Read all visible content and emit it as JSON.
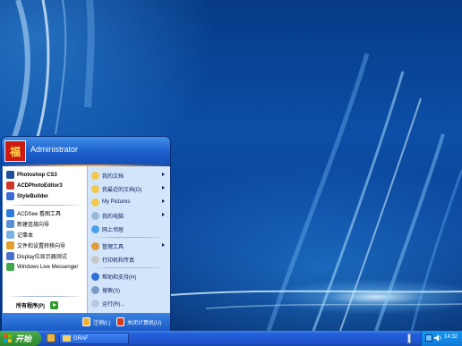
{
  "start_menu": {
    "username": "Administrator",
    "avatar_glyph": "福",
    "pinned": [
      {
        "label": "Photoshop CS3",
        "icon": "photoshop-icon",
        "color": "#1f4f9a"
      },
      {
        "label": "ACDPhotoEditor3",
        "icon": "acd-photo-editor-icon",
        "color": "#d0352a"
      },
      {
        "label": "StyleBuilder",
        "icon": "stylebuilder-icon",
        "color": "#3a6bd6"
      }
    ],
    "recent": [
      {
        "label": "ACDSee 看图工具",
        "icon": "acdsee-icon",
        "color": "#2f7bd8"
      },
      {
        "label": "新建连接向导",
        "icon": "network-wizard-icon",
        "color": "#5a8fd8"
      },
      {
        "label": "记事本",
        "icon": "notepad-icon",
        "color": "#7ab0e6"
      },
      {
        "label": "文件和设置转移向导",
        "icon": "transfer-wizard-icon",
        "color": "#e0a030"
      },
      {
        "label": "Display位显示器测试",
        "icon": "display-test-icon",
        "color": "#4a70c8"
      },
      {
        "label": "Windows Live Messenger",
        "icon": "messenger-icon",
        "color": "#3fa84a"
      }
    ],
    "all_programs_label": "所有程序(P)",
    "places": [
      {
        "label": "我的文档",
        "icon": "my-documents-icon",
        "color": "#f2c94c",
        "arrow": true,
        "bold": true
      },
      {
        "label": "我最近的文档(D)",
        "icon": "recent-documents-icon",
        "color": "#f2c94c",
        "arrow": true,
        "bold": true
      },
      {
        "label": "My Pictures",
        "icon": "my-pictures-icon",
        "color": "#f2c94c",
        "arrow": true,
        "bold": true
      },
      {
        "label": "我的电脑",
        "icon": "my-computer-icon",
        "color": "#9ab8d8",
        "arrow": true,
        "bold": true
      },
      {
        "label": "网上邻居",
        "icon": "network-places-icon",
        "color": "#4aa0e8",
        "arrow": false,
        "bold": true
      },
      {
        "label": "管理工具",
        "icon": "admin-tools-icon",
        "color": "#e09a3a",
        "arrow": true,
        "bold": false
      },
      {
        "label": "打印机和传真",
        "icon": "printers-icon",
        "color": "#c8c8c8",
        "arrow": false,
        "bold": false
      },
      {
        "label": "帮助和支持(H)",
        "icon": "help-icon",
        "color": "#2f6fd6",
        "arrow": false,
        "bold": false
      },
      {
        "label": "搜索(S)",
        "icon": "search-icon",
        "color": "#7a9ac8",
        "arrow": false,
        "bold": false
      },
      {
        "label": "运行(R)...",
        "icon": "run-icon",
        "color": "#b8c8e0",
        "arrow": false,
        "bold": false
      }
    ],
    "logoff_label": "注销(L)",
    "shutdown_label": "关闭计算机(U)"
  },
  "taskbar": {
    "start_label": "开始",
    "task_label": "GRAF",
    "clock": "14:32"
  }
}
